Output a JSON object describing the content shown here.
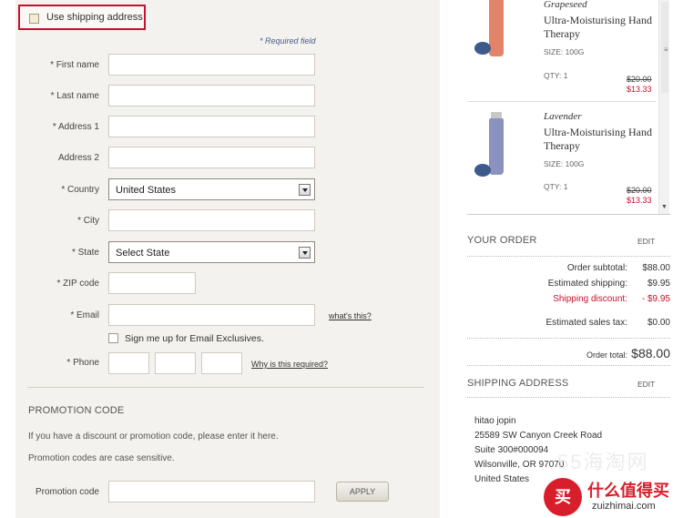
{
  "shipping_toggle": {
    "label": "Use shipping address",
    "checked": false
  },
  "required_note": "* Required field",
  "form": {
    "first_name_label": "* First name",
    "last_name_label": "* Last name",
    "address1_label": "* Address 1",
    "address2_label": "Address 2",
    "country_label": "* Country",
    "country_value": "United States",
    "city_label": "* City",
    "state_label": "* State",
    "state_value": "Select State",
    "zip_label": "* ZIP code",
    "email_label": "* Email",
    "email_help_link": "what's this?",
    "email_optin_label": "Sign me up for Email Exclusives.",
    "phone_label": "* Phone",
    "phone_help_link": "Why is this required?"
  },
  "promotion": {
    "title": "PROMOTION CODE",
    "line1": "If you have a discount or promotion code, please enter it here.",
    "line2": "Promotion codes are case sensitive.",
    "code_label": "Promotion code",
    "apply_label": "APPLY"
  },
  "cart": {
    "items": [
      {
        "variant": "Grapeseed",
        "title": "Ultra-Moisturising Hand Therapy",
        "size": "SIZE: 100G",
        "qty": "QTY: 1",
        "old_price": "$20.00",
        "new_price": "$13.33",
        "tube_color": "#e2846a"
      },
      {
        "variant": "Lavender",
        "title": "Ultra-Moisturising Hand Therapy",
        "size": "SIZE: 100G",
        "qty": "QTY: 1",
        "old_price": "$20.00",
        "new_price": "$13.33",
        "tube_color": "#8a93bd"
      }
    ]
  },
  "order": {
    "title": "YOUR ORDER",
    "edit_label": "EDIT",
    "subtotal_label": "Order subtotal:",
    "subtotal_value": "$88.00",
    "shipping_label": "Estimated shipping:",
    "shipping_value": "$9.95",
    "discount_label": "Shipping discount:",
    "discount_value": "- $9.95",
    "tax_label": "Estimated sales tax:",
    "tax_value": "$0.00",
    "total_label": "Order total:",
    "total_value": "$88.00"
  },
  "shipping_address": {
    "title": "SHIPPING ADDRESS",
    "edit_label": "EDIT",
    "lines": [
      "hitao jopin",
      "25589 SW Canyon Creek Road",
      "Suite 300#000094",
      "Wilsonville, OR 97070",
      "United States"
    ]
  },
  "watermark": {
    "faint": "55海淘网",
    "logo_char": "买",
    "cn_text": "什么值得买",
    "en_text": "zuizhimai.com"
  },
  "colors": {
    "accent_red": "#c8102e",
    "panel_bg": "#f4f2ee"
  }
}
